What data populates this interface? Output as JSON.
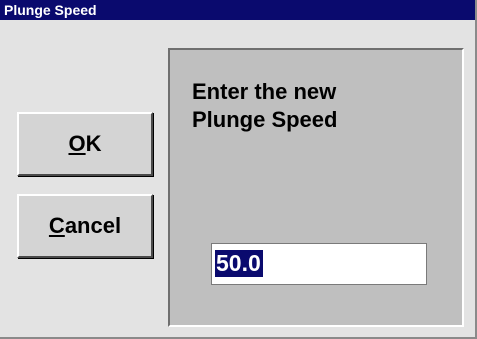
{
  "window": {
    "title": "Plunge Speed"
  },
  "buttons": {
    "ok": {
      "mnemonic": "O",
      "rest": "K"
    },
    "cancel": {
      "mnemonic": "C",
      "rest": "ancel"
    }
  },
  "prompt": {
    "line1": "Enter the new",
    "line2": "Plunge Speed"
  },
  "input": {
    "value": "50.0",
    "selected": true
  },
  "colors": {
    "titlebar": "#0a0a6e",
    "selection": "#0a0a6e",
    "dialog_bg": "#e3e3e3",
    "panel_bg": "#bfbfbf"
  }
}
